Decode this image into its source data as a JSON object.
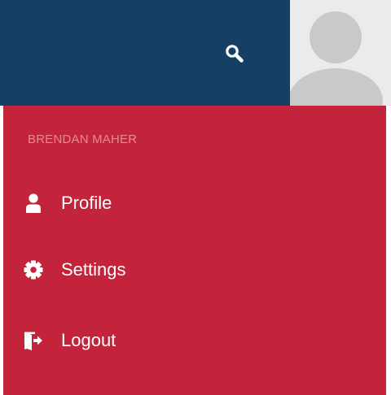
{
  "colors": {
    "topbar": "#163f65",
    "dropdown": "#c3233b",
    "username_text": "#e88a98",
    "menu_text": "#ffffff",
    "avatar_bg": "#ebebeb",
    "avatar_figure": "#c9c9c9"
  },
  "header": {
    "search_icon": "search-icon",
    "avatar_icon": "default-avatar-icon"
  },
  "dropdown": {
    "username": "BRENDAN MAHER",
    "items": [
      {
        "label": "Profile",
        "icon": "user-icon"
      },
      {
        "label": "Settings",
        "icon": "gear-icon"
      },
      {
        "label": "Logout",
        "icon": "logout-icon"
      }
    ]
  }
}
